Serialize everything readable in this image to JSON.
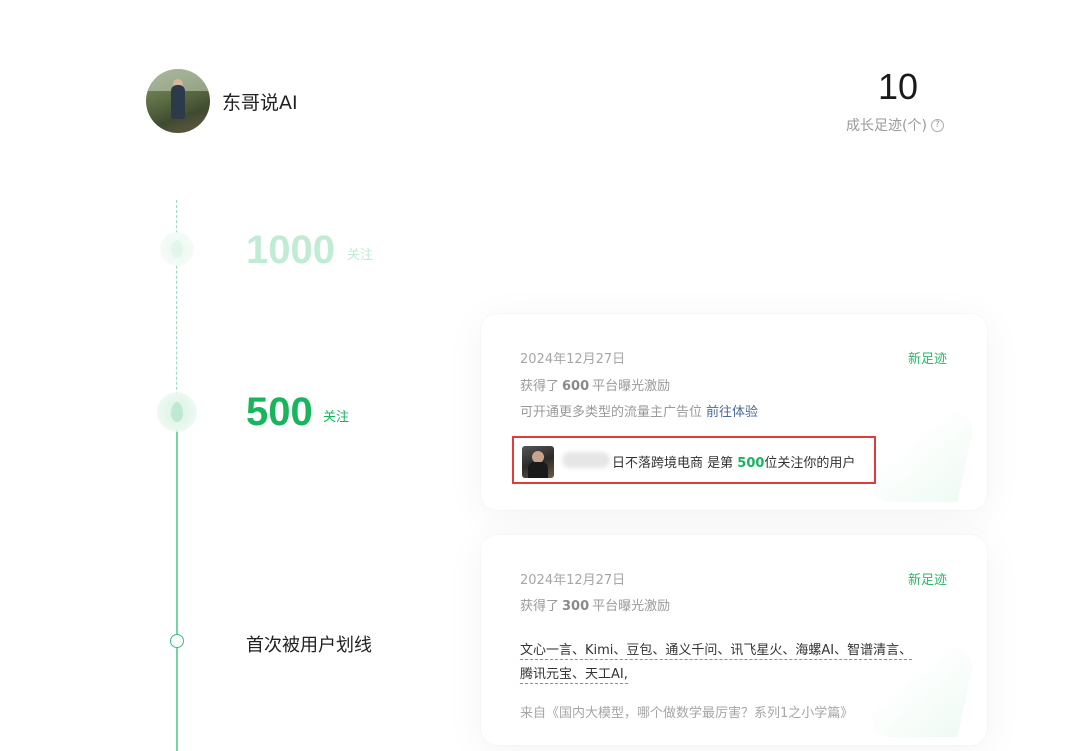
{
  "profile": {
    "name": "东哥说AI"
  },
  "stats": {
    "count": "10",
    "label": "成长足迹(个)",
    "help_icon": "?"
  },
  "milestones": {
    "m1000": {
      "number": "1000",
      "unit": "关注"
    },
    "m500": {
      "number": "500",
      "unit": "关注"
    },
    "first": {
      "label": "首次被用户划线"
    }
  },
  "cards": [
    {
      "date": "2024年12月27日",
      "badge": "新足迹",
      "reward_prefix": "获得了",
      "reward_amount": "600",
      "reward_suffix": "平台曝光激励",
      "ad_text": "可开通更多类型的流量主广告位",
      "ad_link": "前往体验",
      "follower": {
        "name_suffix": "日不落跨境电商",
        "text_before": " 是第 ",
        "rank": "500",
        "text_after": "位关注你的用户"
      }
    },
    {
      "date": "2024年12月27日",
      "badge": "新足迹",
      "reward_prefix": "获得了",
      "reward_amount": "300",
      "reward_suffix": "平台曝光激励",
      "quote_line1": "文心一言、Kimi、豆包、通义千问、讯飞星火、海螺AI、智谱清言、",
      "quote_line2": "腾讯元宝、天工AI,",
      "source": "来自《国内大模型，哪个做数学最厉害？系列1之小学篇》"
    }
  ]
}
